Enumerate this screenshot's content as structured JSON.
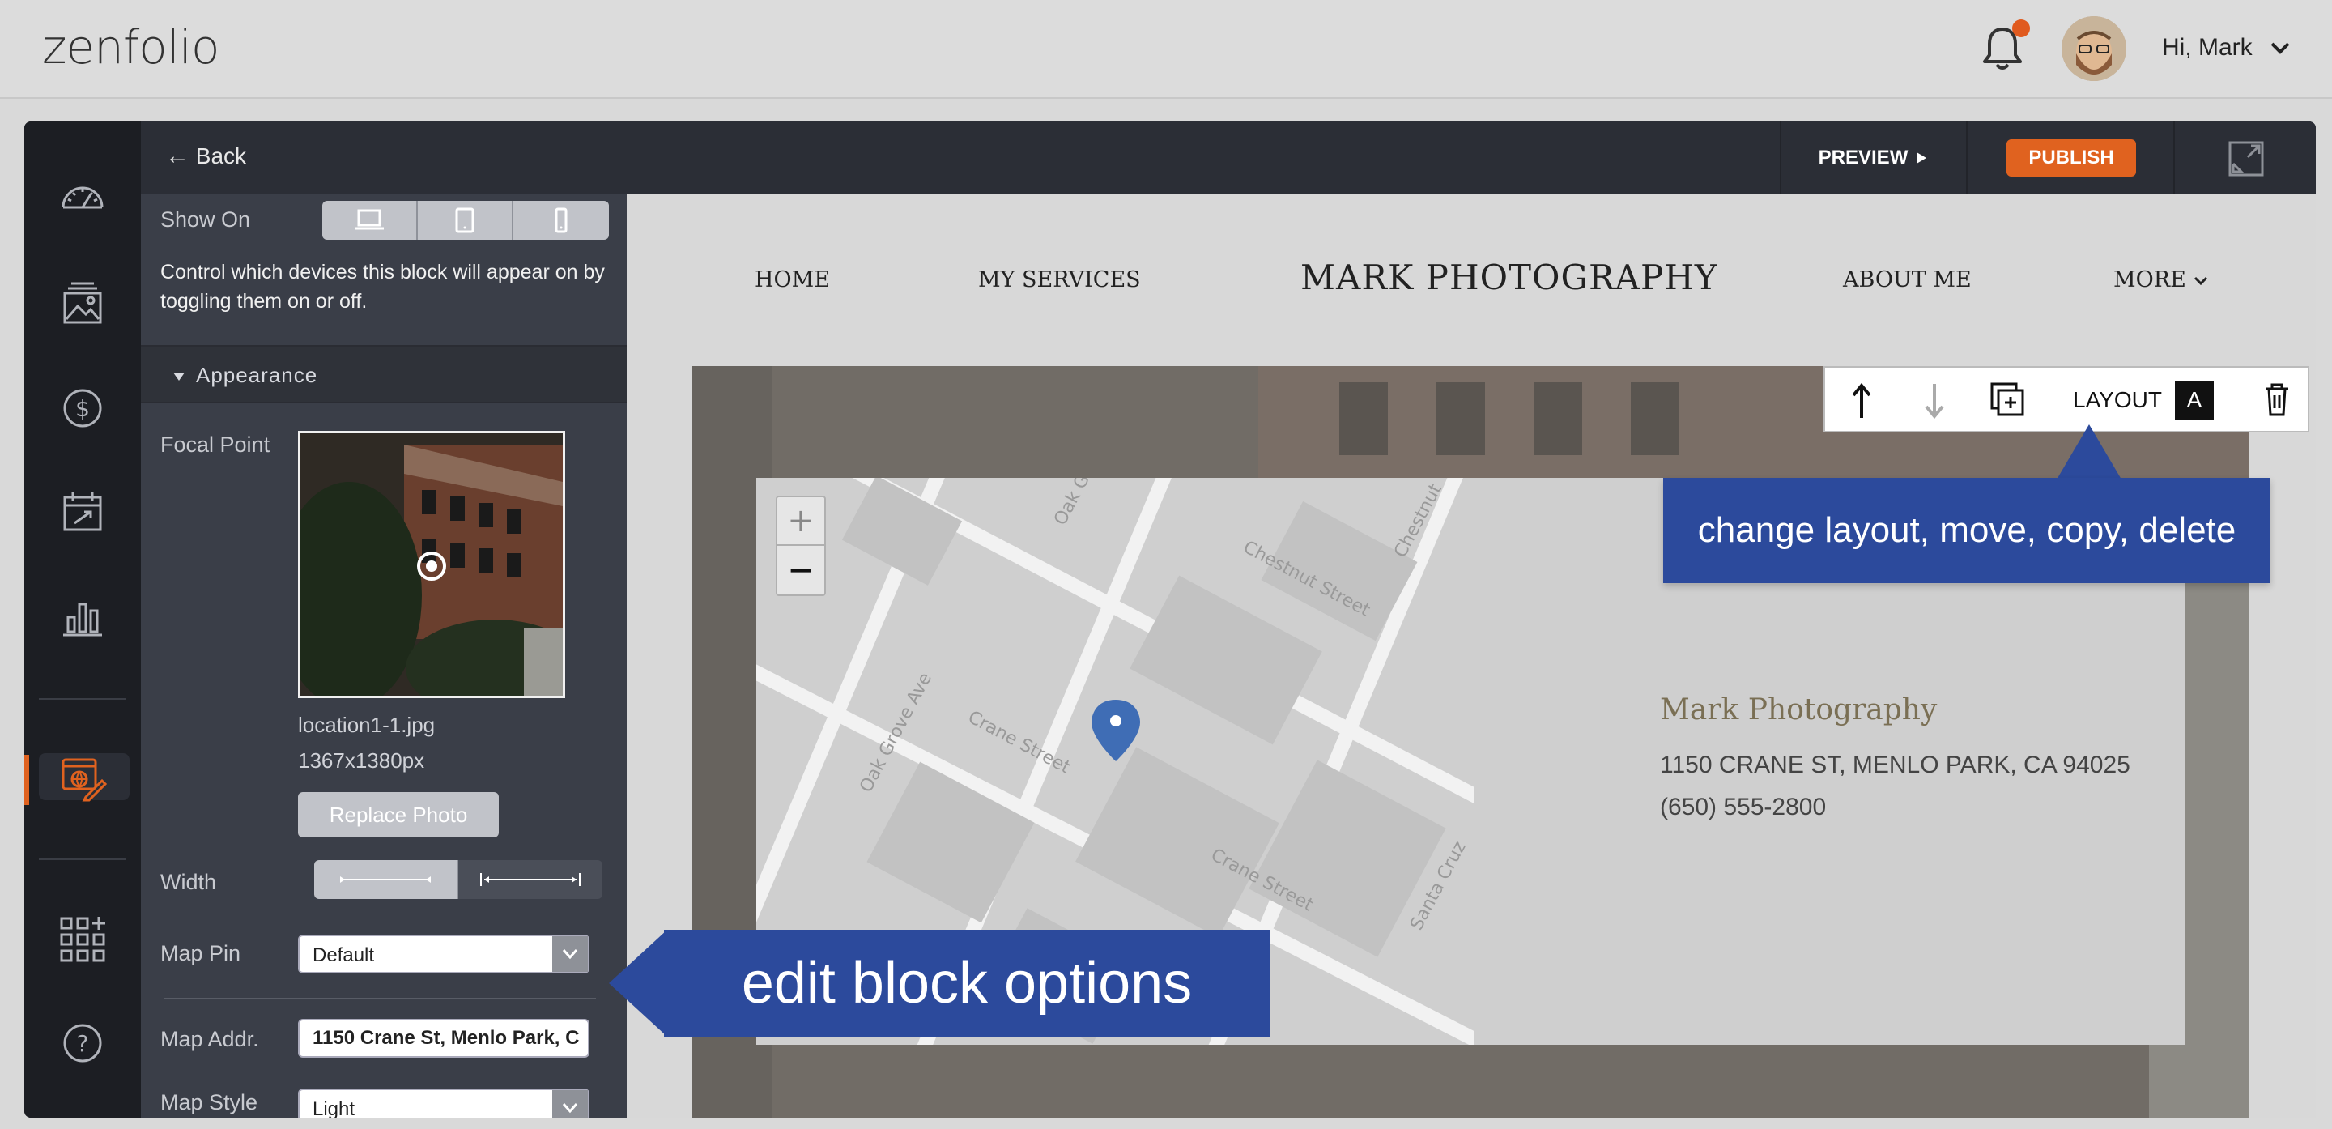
{
  "app": {
    "logo": "zenfolio",
    "greeting": "Hi, Mark"
  },
  "panel": {
    "back_label": "Back",
    "show_on_label": "Show On",
    "show_on_help": "Control which devices this block will appear on by toggling them on or off.",
    "appearance_label": "Appearance",
    "focal_point_label": "Focal Point",
    "file_name": "location1-1.jpg",
    "file_dims": "1367x1380px",
    "replace_label": "Replace Photo",
    "width_label": "Width",
    "map_pin_label": "Map Pin",
    "map_pin_value": "Default",
    "map_addr_label": "Map Addr.",
    "map_addr_value": "1150 Crane St, Menlo Park, C",
    "map_style_label": "Map Style",
    "map_style_value": "Light"
  },
  "toolbar": {
    "preview_label": "PREVIEW",
    "publish_label": "PUBLISH"
  },
  "site": {
    "nav": [
      "HOME",
      "MY SERVICES",
      "ABOUT ME",
      "MORE"
    ],
    "brand": "MARK PHOTOGRAPHY",
    "info_name": "Mark Photography",
    "info_address": "1150 CRANE ST, MENLO PARK, CA 94025",
    "info_phone": "(650) 555-2800"
  },
  "map": {
    "streets": [
      "Oak Grove Ave",
      "Crane Street",
      "Crane Street",
      "Chestnut Street",
      "Chestnut",
      "Santa Cruz",
      "Oak G"
    ],
    "zoom_in": "+",
    "zoom_out": "−"
  },
  "block_toolbar": {
    "layout_label": "LAYOUT",
    "layout_value": "A"
  },
  "callouts": {
    "toolbar_hint": "change layout, move, copy, delete",
    "panel_hint": "edit block options"
  },
  "colors": {
    "accent": "#e0621f",
    "callout": "#2c4a9c",
    "panel": "#3a3e48"
  }
}
